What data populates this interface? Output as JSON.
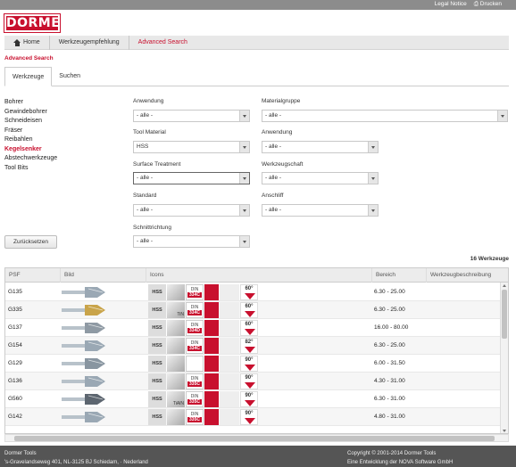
{
  "topbar": {
    "legal": "Legal Notice",
    "print": "Drucken"
  },
  "logo": "DORMER",
  "nav": {
    "home": "Home",
    "recommendation": "Werkzeugempfehlung",
    "advanced": "Advanced Search"
  },
  "page_title": "Advanced Search",
  "tabs": {
    "tools": "Werkzeuge",
    "search": "Suchen"
  },
  "categories": [
    "Bohrer",
    "Gewindebohrer",
    "Schneideisen",
    "Fräser",
    "Reibahlen",
    "Kegelsenker",
    "Abstechwerkzeuge",
    "Tool Bits"
  ],
  "filters": {
    "application_label": "Anwendung",
    "application_value": "- alle -",
    "tool_material_label": "Tool Material",
    "tool_material_value": "HSS",
    "surface_label": "Surface Treatment",
    "surface_value": "- alle -",
    "standard_label": "Standard",
    "standard_value": "- alle -",
    "cutting_dir_label": "Schnittrichtung",
    "cutting_dir_value": "- alle -",
    "material_group_label": "Materialgruppe",
    "material_group_value": "- alle -",
    "application2_label": "Anwendung",
    "application2_value": "- alle -",
    "shank_label": "Werkzeugschaft",
    "shank_value": "- alle -",
    "grind_label": "Anschliff",
    "grind_value": "- alle -"
  },
  "reset_label": "Zurücksetzen",
  "count_label": "16 Werkzeuge",
  "columns": [
    "PSF",
    "Bild",
    "Icons",
    "Bereich",
    "Werkzeugbeschreibung"
  ],
  "rows": [
    {
      "psf": "G135",
      "coat": "",
      "din_label": "DIN",
      "din": "334C",
      "angle": "60°",
      "range": "6.30 - 25.00",
      "tool_color": "#9aa8b4"
    },
    {
      "psf": "G335",
      "coat": "TiN",
      "din_label": "DIN",
      "din": "334C",
      "angle": "60°",
      "range": "6.30 - 25.00",
      "tool_color": "#c9a44a"
    },
    {
      "psf": "G137",
      "coat": "",
      "din_label": "DIN",
      "din": "334D",
      "angle": "60°",
      "range": "16.00 - 80.00",
      "tool_color": "#8f9aa4"
    },
    {
      "psf": "G154",
      "coat": "",
      "din_label": "DIN",
      "din": "334C",
      "angle": "82°",
      "range": "6.30 - 25.00",
      "tool_color": "#9aa8b4"
    },
    {
      "psf": "G129",
      "coat": "",
      "din_label": "",
      "din": "",
      "angle": "90°",
      "range": "6.00 - 31.50",
      "tool_color": "#8895a0"
    },
    {
      "psf": "G136",
      "coat": "",
      "din_label": "DIN",
      "din": "335C",
      "angle": "90°",
      "range": "4.30 - 31.00",
      "tool_color": "#9aa8b4"
    },
    {
      "psf": "G560",
      "coat": "TiAlN",
      "din_label": "DIN",
      "din": "335C",
      "angle": "90°",
      "range": "6.30 - 31.00",
      "tool_color": "#5d6670"
    },
    {
      "psf": "G142",
      "coat": "",
      "din_label": "DIN",
      "din": "335C",
      "angle": "90°",
      "range": "4.80 - 31.00",
      "tool_color": "#9aa8b4"
    }
  ],
  "material_icon": "HSS",
  "footer": {
    "company": "Dormer Tools",
    "address": "'s-Gravelandseweg 401, NL-3125 BJ Schiedam, · Nederland",
    "copyright": "Copyright © 2001-2014 Dormer Tools",
    "developer": "Eine Entwicklung der NOVA Software GmbH"
  },
  "colors": {
    "brand": "#c8102e",
    "topbar": "#8c8c8c",
    "footer": "#555555"
  }
}
